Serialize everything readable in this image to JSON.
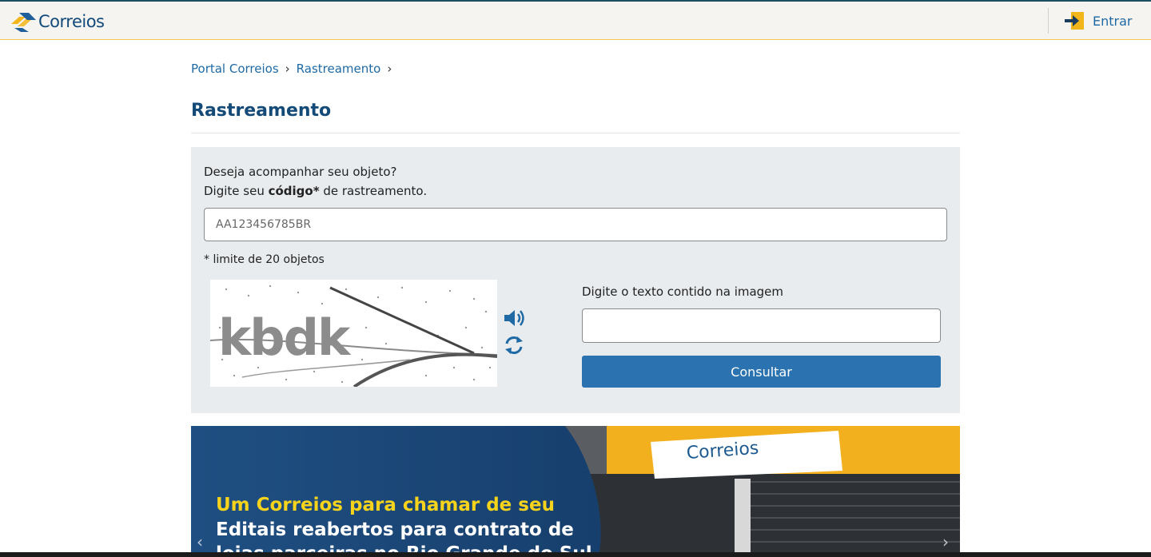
{
  "header": {
    "logo_text": "Correios",
    "login_label": "Entrar"
  },
  "breadcrumb": {
    "items": [
      "Portal Correios",
      "Rastreamento"
    ],
    "separator": "›"
  },
  "page": {
    "title": "Rastreamento"
  },
  "tracking_form": {
    "intro_line1": "Deseja acompanhar seu objeto?",
    "intro_line2_prefix": "Digite seu ",
    "intro_line2_bold": "código*",
    "intro_line2_suffix": " de rastreamento.",
    "code_placeholder": "AA123456785BR",
    "limit_note": "* limite de 20 objetos",
    "captcha_text": "kbdk",
    "captcha_label": "Digite o texto contido na imagem",
    "submit_label": "Consultar"
  },
  "banner": {
    "line1": "Um Correios para chamar de seu",
    "line2": "Editais reabertos para contrato de",
    "line3": "lojas parceiras no Rio Grande do Sul",
    "sign_text": "Correios",
    "prev_arrow": "‹",
    "next_arrow": "›"
  },
  "colors": {
    "brand_blue": "#114a7a",
    "link_blue": "#1f6aa5",
    "button_blue": "#2a72b0",
    "brand_yellow": "#f7d31c"
  },
  "icons": {
    "audio": "volume-icon",
    "refresh": "refresh-icon",
    "login": "sign-in-icon"
  }
}
